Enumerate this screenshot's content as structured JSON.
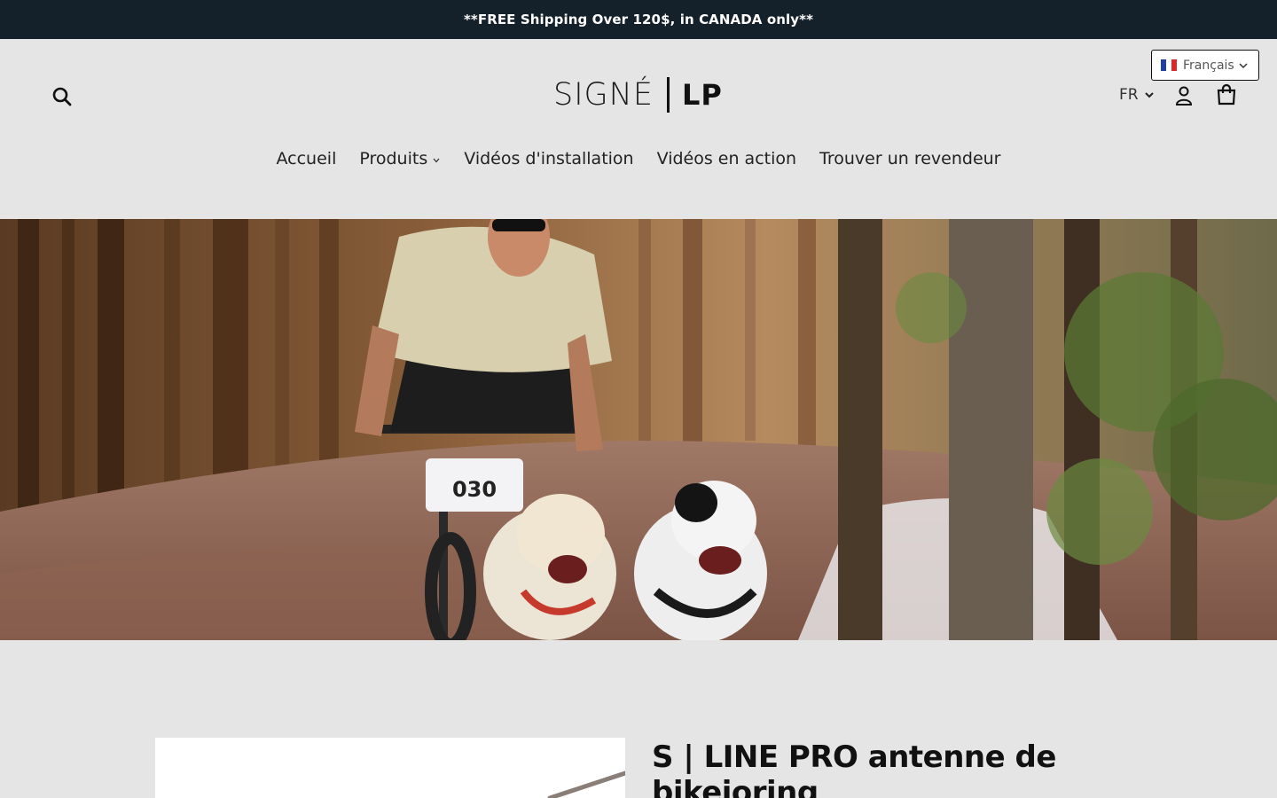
{
  "announcement": {
    "text": "**FREE Shipping Over 120$, in CANADA only**"
  },
  "header": {
    "logo": {
      "left": "SIGNÉ",
      "right": "LP"
    },
    "language": {
      "selected": "Français",
      "flag_colors": [
        "#1f3ea8",
        "#ffffff",
        "#e0242c"
      ]
    },
    "currency": {
      "selected": "FR"
    },
    "icons": {
      "search": "search-icon",
      "account": "user-icon",
      "cart": "cart-icon"
    }
  },
  "nav": {
    "items": [
      {
        "label": "Accueil"
      },
      {
        "label": "Produits",
        "has_dropdown": true
      },
      {
        "label": "Vidéos d'installation"
      },
      {
        "label": "Vidéos en action"
      },
      {
        "label": "Trouver un revendeur"
      }
    ]
  },
  "hero": {
    "image": "Cyclist bikejoring on forest trail with two dogs"
  },
  "product": {
    "title": "S | LINE PRO antenne de bikejoring"
  },
  "colors": {
    "announcement_bg": "#14202a",
    "page_bg": "#e5e5e5",
    "text": "#111111"
  }
}
